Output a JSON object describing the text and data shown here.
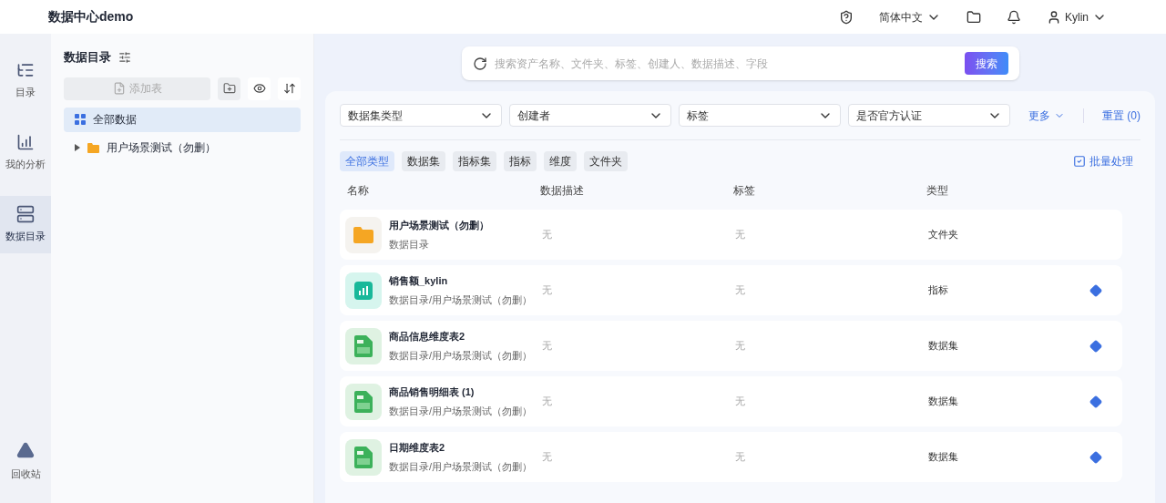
{
  "header": {
    "title": "数据中心demo",
    "language": "简体中文",
    "user": "Kylin"
  },
  "nav": [
    {
      "label": "目录",
      "kind": "list",
      "selected": false
    },
    {
      "label": "我的分析",
      "kind": "chart",
      "selected": false
    },
    {
      "label": "数据目录",
      "kind": "catalog",
      "selected": true
    }
  ],
  "nav_bottom": {
    "label": "回收站"
  },
  "catalog": {
    "title": "数据目录",
    "add_button": "添加表",
    "tree": [
      {
        "label": "全部数据",
        "kind": "all",
        "selected": true
      },
      {
        "label": "用户场景测试（勿删）",
        "kind": "folder",
        "selected": false,
        "expanded": false
      }
    ]
  },
  "search": {
    "placeholder": "搜索资产名称、文件夹、标签、创建人、数据描述、字段",
    "button": "搜索"
  },
  "filters": [
    {
      "placeholder": "数据集类型"
    },
    {
      "placeholder": "创建者"
    },
    {
      "placeholder": "标签"
    },
    {
      "placeholder": "是否官方认证"
    }
  ],
  "more": "更多",
  "reset": "重置 (0)",
  "type_tabs": [
    {
      "label": "全部类型",
      "selected": true
    },
    {
      "label": "数据集",
      "selected": false
    },
    {
      "label": "指标集",
      "selected": false
    },
    {
      "label": "指标",
      "selected": false
    },
    {
      "label": "维度",
      "selected": false
    },
    {
      "label": "文件夹",
      "selected": false
    }
  ],
  "batch": "批量处理",
  "table": {
    "columns": [
      "名称",
      "数据描述",
      "标签",
      "类型"
    ],
    "rows": [
      {
        "kind": "folder",
        "name": "用户场景测试（勿删）",
        "path": "数据目录",
        "description": "无",
        "tags": "无",
        "type": "文件夹",
        "action": false
      },
      {
        "kind": "metric",
        "name": "销售额_kylin",
        "path": "数据目录/用户场景测试（勿删）",
        "description": "无",
        "tags": "无",
        "type": "指标",
        "action": true
      },
      {
        "kind": "dataset",
        "name": "商品信息维度表2",
        "path": "数据目录/用户场景测试（勿删）",
        "description": "无",
        "tags": "无",
        "type": "数据集",
        "action": true
      },
      {
        "kind": "dataset",
        "name": "商品销售明细表 (1)",
        "path": "数据目录/用户场景测试（勿删）",
        "description": "无",
        "tags": "无",
        "type": "数据集",
        "action": true
      },
      {
        "kind": "dataset",
        "name": "日期维度表2",
        "path": "数据目录/用户场景测试（勿删）",
        "description": "无",
        "tags": "无",
        "type": "数据集",
        "action": true
      }
    ]
  }
}
